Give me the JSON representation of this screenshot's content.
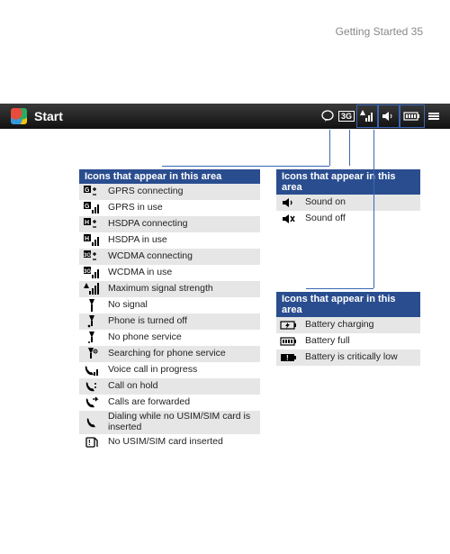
{
  "page": {
    "header": "Getting Started  35"
  },
  "startbar": {
    "label": "Start",
    "badge_3g": "3G"
  },
  "sections": {
    "signal": {
      "title": "Icons that appear in this area",
      "items": [
        "GPRS connecting",
        "GPRS in use",
        "HSDPA connecting",
        "HSDPA in use",
        "WCDMA connecting",
        "WCDMA in use",
        "Maximum signal strength",
        "No signal",
        "Phone is turned off",
        "No phone service",
        "Searching for phone service",
        "Voice call in progress",
        "Call on hold",
        "Calls are forwarded",
        "Dialing while no USIM/SIM card is inserted",
        "No USIM/SIM card inserted"
      ]
    },
    "sound": {
      "title": "Icons that appear in this area",
      "items": [
        "Sound on",
        "Sound off"
      ]
    },
    "battery": {
      "title": "Icons that appear in this area",
      "items": [
        "Battery charging",
        "Battery full",
        "Battery is critically low"
      ]
    }
  }
}
